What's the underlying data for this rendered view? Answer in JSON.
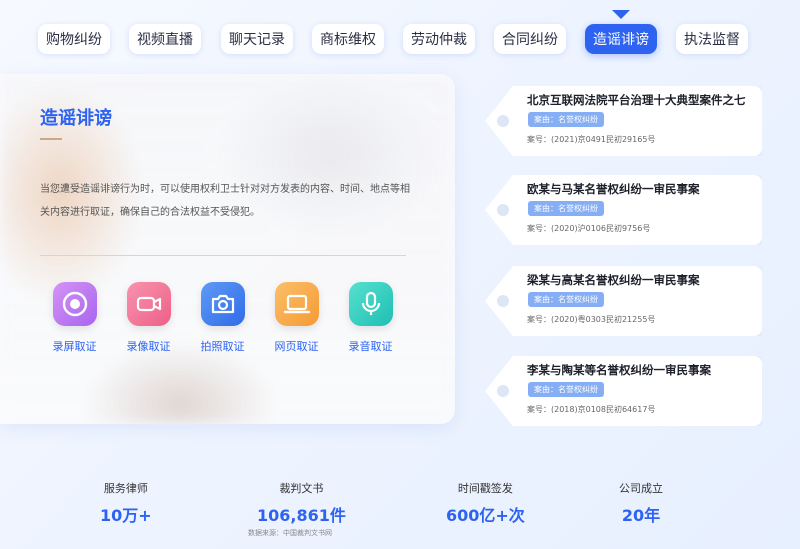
{
  "tabs": [
    {
      "label": "购物纠纷"
    },
    {
      "label": "视频直播"
    },
    {
      "label": "聊天记录"
    },
    {
      "label": "商标维权"
    },
    {
      "label": "劳动仲裁"
    },
    {
      "label": "合同纠纷"
    },
    {
      "label": "造谣诽谤",
      "active": true
    },
    {
      "label": "执法监督"
    }
  ],
  "panel": {
    "title": "造谣诽谤",
    "description": "当您遭受造谣诽谤行为时，可以使用权利卫士针对对方发表的内容、时间、地点等相关内容进行取证，确保自己的合法权益不受侵犯。",
    "methods": [
      {
        "label": "录屏取证",
        "icon": "screen-record-icon",
        "color": "#c07ef0"
      },
      {
        "label": "录像取证",
        "icon": "video-camera-icon",
        "color": "#f27a9a"
      },
      {
        "label": "拍照取证",
        "icon": "camera-icon",
        "color": "#4a86f0"
      },
      {
        "label": "网页取证",
        "icon": "laptop-icon",
        "color": "#f7a54a"
      },
      {
        "label": "录音取证",
        "icon": "microphone-icon",
        "color": "#2fcfc0"
      }
    ]
  },
  "cases": [
    {
      "title": "北京互联网法院平台治理十大典型案件之七",
      "tag": "案由：名誉权纠纷",
      "number": "案号：(2021)京0491民初29165号"
    },
    {
      "title": "欧某与马某名誉权纠纷一审民事案",
      "tag": "案由：名誉权纠纷",
      "number": "案号：(2020)沪0106民初9756号"
    },
    {
      "title": "梁某与高某名誉权纠纷一审民事案",
      "tag": "案由：名誉权纠纷",
      "number": "案号：(2020)粤0303民初21255号"
    },
    {
      "title": "李某与陶某等名誉权纠纷一审民事案",
      "tag": "案由：名誉权纠纷",
      "number": "案号：(2018)京0108民初64617号"
    }
  ],
  "stats": [
    {
      "label": "服务律师",
      "value": "10万+"
    },
    {
      "label": "裁判文书",
      "value": "106,861件"
    },
    {
      "label": "时间戳签发",
      "value": "600亿+次"
    },
    {
      "label": "公司成立",
      "value": "20年"
    }
  ],
  "source": "数据来源：中国裁判文书网"
}
